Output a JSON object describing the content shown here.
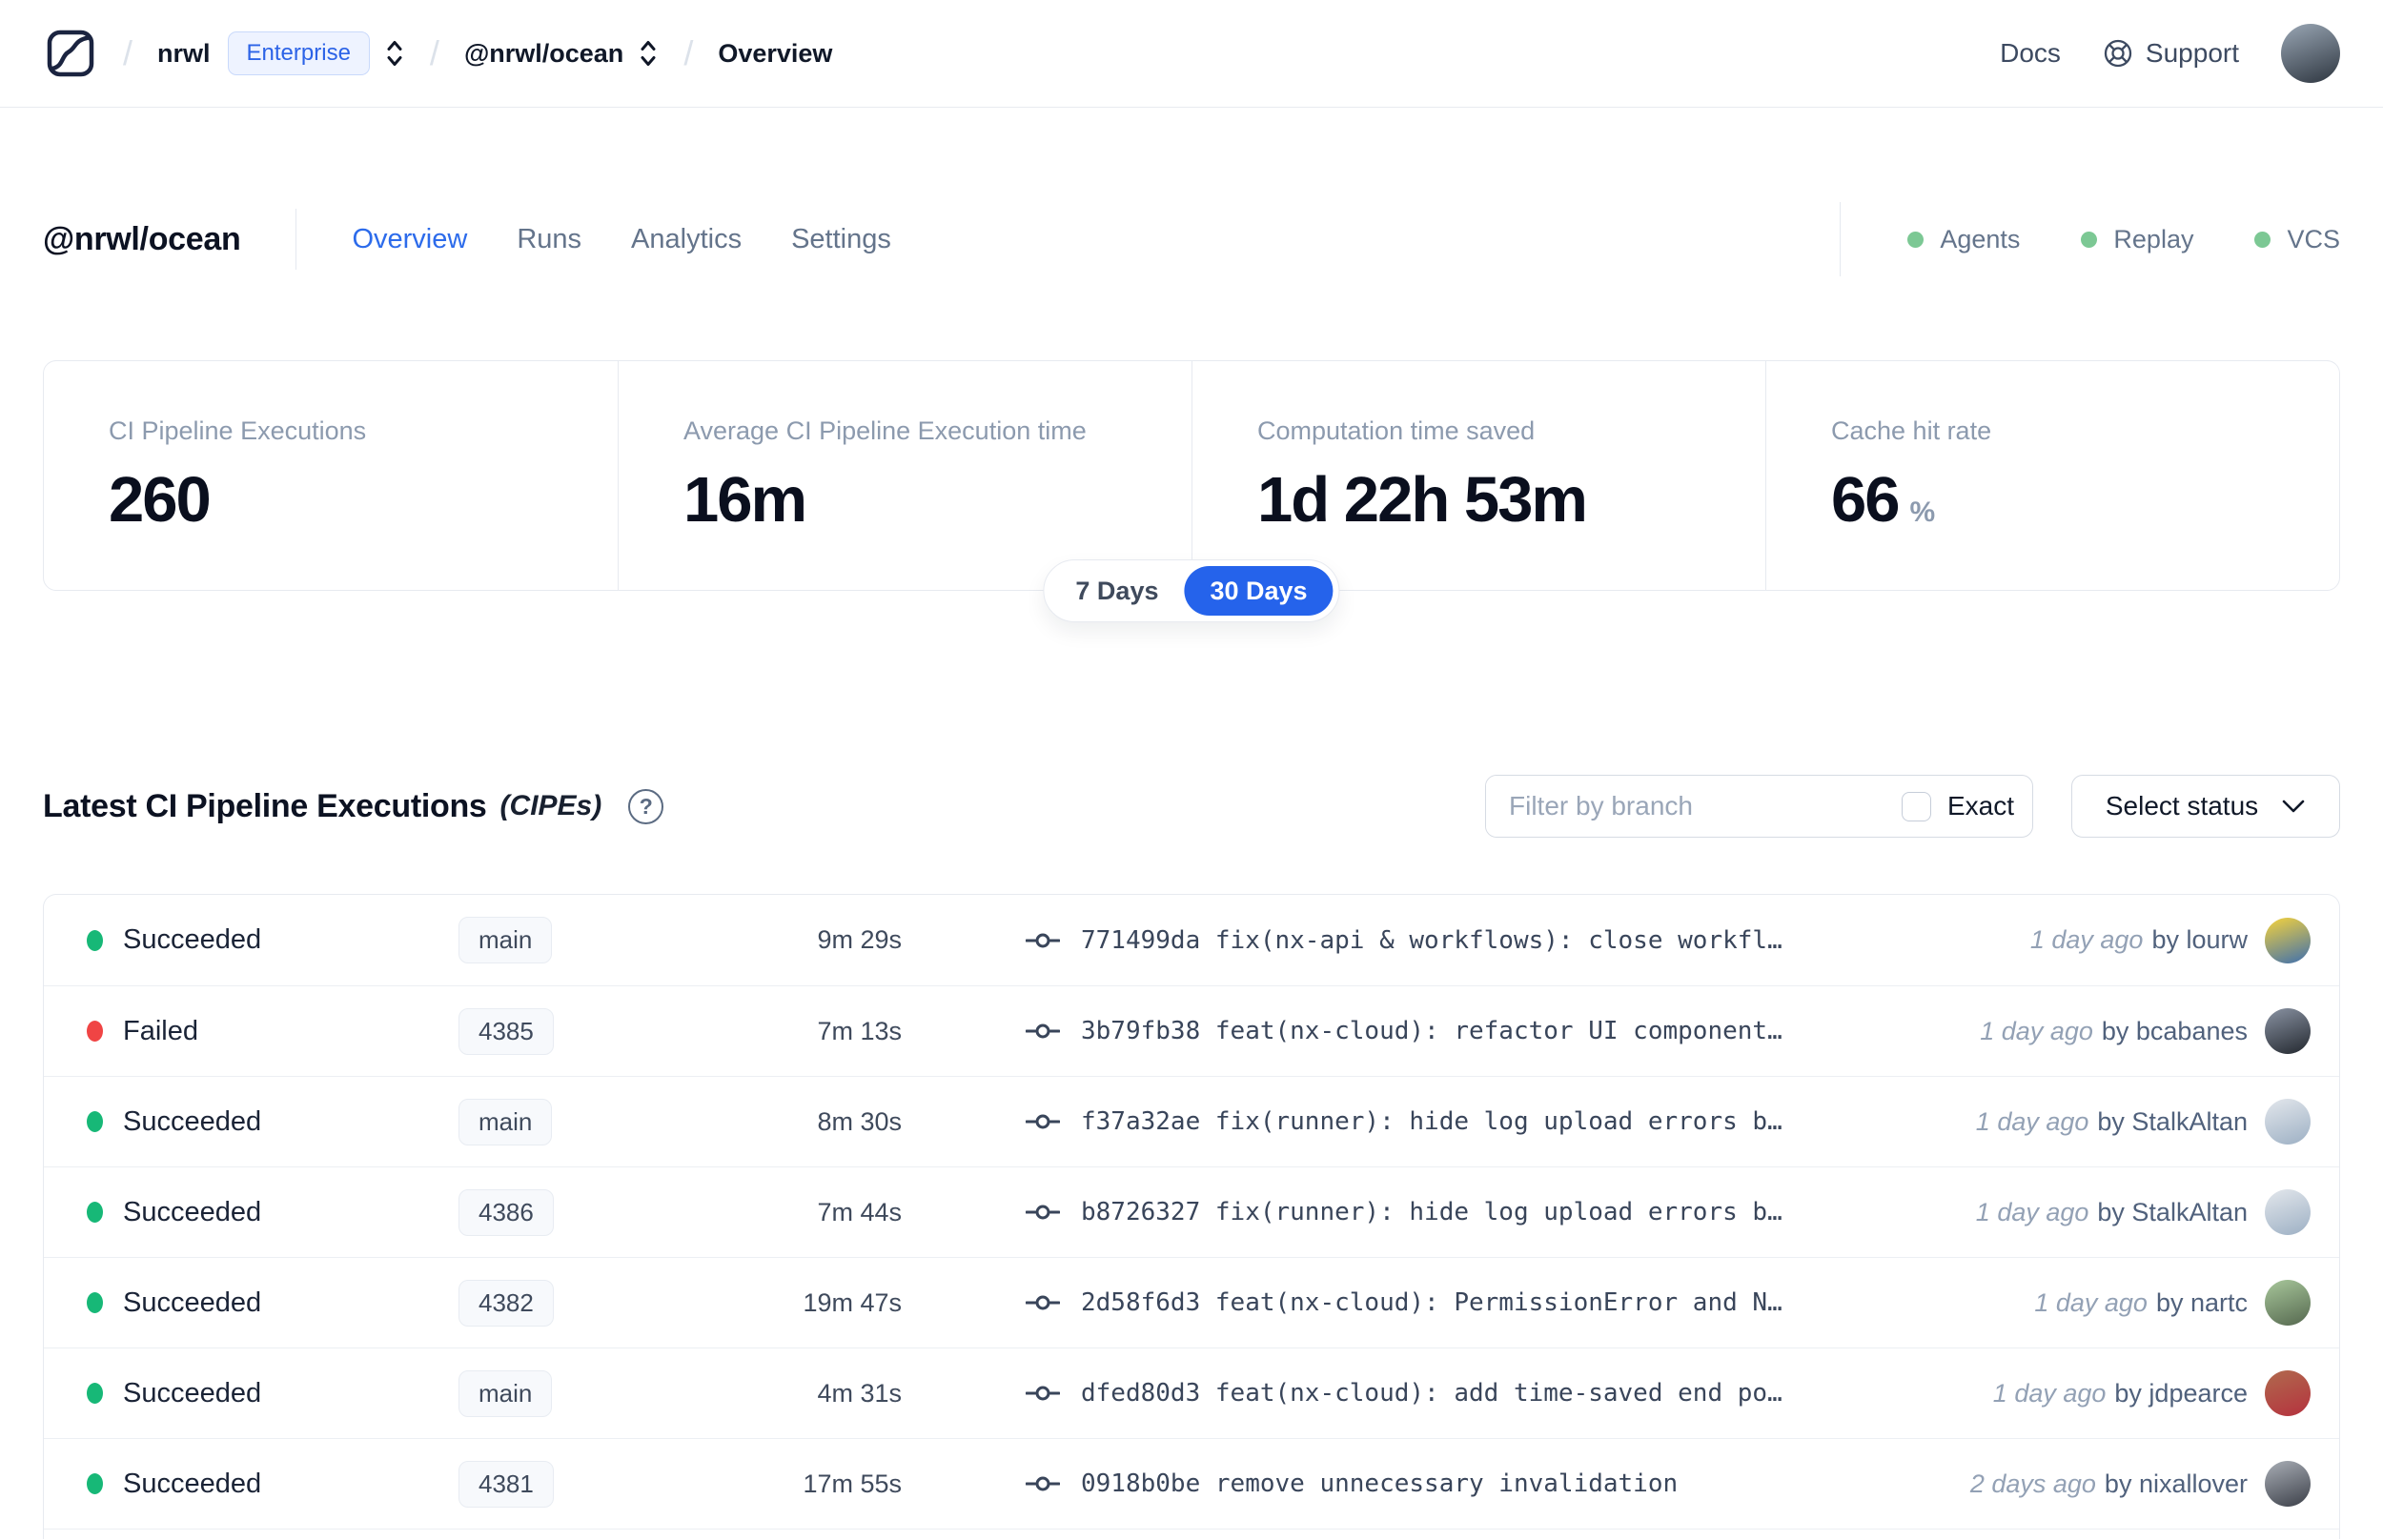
{
  "navbar": {
    "breadcrumb": {
      "org": "nrwl",
      "plan_badge": "Enterprise",
      "workspace": "@nrwl/ocean",
      "page": "Overview"
    },
    "links": {
      "docs": "Docs",
      "support": "Support"
    },
    "avatar_colors": [
      "#9aa7b5",
      "#2e3640"
    ]
  },
  "workspace_header": {
    "title": "@nrwl/ocean",
    "tabs": [
      {
        "label": "Overview",
        "active": true
      },
      {
        "label": "Runs",
        "active": false
      },
      {
        "label": "Analytics",
        "active": false
      },
      {
        "label": "Settings",
        "active": false
      }
    ],
    "statuses": [
      {
        "label": "Agents"
      },
      {
        "label": "Replay"
      },
      {
        "label": "VCS"
      }
    ]
  },
  "stats": {
    "cards": [
      {
        "label": "CI Pipeline Executions",
        "value": "260",
        "suffix": ""
      },
      {
        "label": "Average CI Pipeline Execution time",
        "value": "16m",
        "suffix": ""
      },
      {
        "label": "Computation time saved",
        "value": "1d 22h 53m",
        "suffix": ""
      },
      {
        "label": "Cache hit rate",
        "value": "66",
        "suffix": "%"
      }
    ]
  },
  "range_toggle": {
    "options": [
      {
        "label": "7 Days",
        "selected": false
      },
      {
        "label": "30 Days",
        "selected": true
      }
    ]
  },
  "cipe_section": {
    "title": "Latest CI Pipeline Executions",
    "subtitle": "(CIPEs)",
    "help_icon": "?",
    "filter_placeholder": "Filter by branch",
    "exact_label": "Exact",
    "status_select_label": "Select status"
  },
  "table": {
    "rows": [
      {
        "state": "succeeded",
        "status": "Succeeded",
        "branch": "main",
        "duration": "9m 29s",
        "commit_hash": "771499da",
        "commit_message": "fix(nx-api & workflows): close workfl…",
        "time_ago": "1 day ago",
        "author": "by lourw",
        "avatar_colors": [
          "#f6d33c",
          "#3e6fae"
        ]
      },
      {
        "state": "failed",
        "status": "Failed",
        "branch": "4385",
        "duration": "7m 13s",
        "commit_hash": "3b79fb38",
        "commit_message": "feat(nx-cloud): refactor UI component…",
        "time_ago": "1 day ago",
        "author": "by bcabanes",
        "avatar_colors": [
          "#8a93a3",
          "#23282f"
        ]
      },
      {
        "state": "succeeded",
        "status": "Succeeded",
        "branch": "main",
        "duration": "8m 30s",
        "commit_hash": "f37a32ae",
        "commit_message": "fix(runner): hide log upload errors b…",
        "time_ago": "1 day ago",
        "author": "by StalkAltan",
        "avatar_colors": [
          "#e3e7ec",
          "#9db0c4"
        ]
      },
      {
        "state": "succeeded",
        "status": "Succeeded",
        "branch": "4386",
        "duration": "7m 44s",
        "commit_hash": "b8726327",
        "commit_message": "fix(runner): hide log upload errors b…",
        "time_ago": "1 day ago",
        "author": "by StalkAltan",
        "avatar_colors": [
          "#e3e7ec",
          "#9db0c4"
        ]
      },
      {
        "state": "succeeded",
        "status": "Succeeded",
        "branch": "4382",
        "duration": "19m 47s",
        "commit_hash": "2d58f6d3",
        "commit_message": "feat(nx-cloud): PermissionError and N…",
        "time_ago": "1 day ago",
        "author": "by nartc",
        "avatar_colors": [
          "#a8c79b",
          "#55684f"
        ]
      },
      {
        "state": "succeeded",
        "status": "Succeeded",
        "branch": "main",
        "duration": "4m 31s",
        "commit_hash": "dfed80d3",
        "commit_message": "feat(nx-cloud): add time-saved end po…",
        "time_ago": "1 day ago",
        "author": "by jdpearce",
        "avatar_colors": [
          "#b06a4e",
          "#b5323e"
        ]
      },
      {
        "state": "succeeded",
        "status": "Succeeded",
        "branch": "4381",
        "duration": "17m 55s",
        "commit_hash": "0918b0be",
        "commit_message": "remove unnecessary invalidation",
        "time_ago": "2 days ago",
        "author": "by nixallover",
        "avatar_colors": [
          "#a9aeb6",
          "#3c4049"
        ]
      }
    ]
  },
  "colors": {
    "accent": "#2c6beb",
    "toggle_selected_bg": "#2563eb",
    "success_dot": "#17b877",
    "failed_dot": "#f04444",
    "status_indicator": "#7cc894",
    "enterprise_badge_text": "#2c63e7",
    "enterprise_badge_bg": "#eef3ff"
  }
}
